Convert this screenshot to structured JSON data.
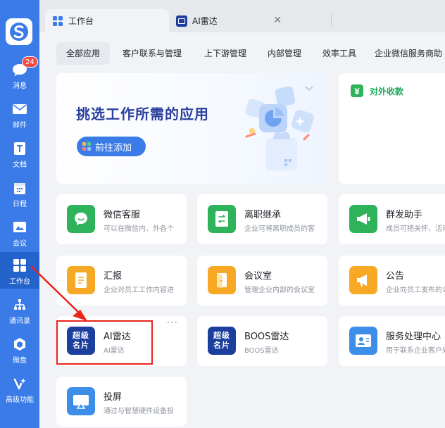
{
  "sidebar": {
    "items": [
      {
        "label": "消息",
        "icon": "chat-icon",
        "badge": "24"
      },
      {
        "label": "邮件",
        "icon": "mail-icon"
      },
      {
        "label": "文档",
        "icon": "document-icon"
      },
      {
        "label": "日程",
        "icon": "calendar-icon"
      },
      {
        "label": "会议",
        "icon": "meeting-icon"
      },
      {
        "label": "工作台",
        "icon": "workbench-icon",
        "active": true
      },
      {
        "label": "通讯录",
        "icon": "contacts-icon"
      },
      {
        "label": "微盘",
        "icon": "drive-icon"
      },
      {
        "label": "高级功能",
        "icon": "advanced-icon"
      }
    ]
  },
  "tabs": [
    {
      "title": "工作台",
      "icon": "grid-icon",
      "active": true
    },
    {
      "title": "AI雷达",
      "icon": "radar-app-icon",
      "close": "✕"
    }
  ],
  "categories": [
    "全部应用",
    "客户联系与管理",
    "上下游管理",
    "内部管理",
    "效率工具",
    "企业微信服务商助"
  ],
  "banner": {
    "title": "挑选工作所需的应用",
    "button": "前往添加"
  },
  "pay_card": {
    "title": "对外收款"
  },
  "apps": [
    {
      "name": "微信客服",
      "desc": "可以在微信内、外各个场景接入微信客服",
      "icon": "chat-bubble-icon",
      "color": "green"
    },
    {
      "name": "离职继承",
      "desc": "企业可将离职成员的客户分配给在职成员",
      "icon": "transfer-icon",
      "color": "green"
    },
    {
      "name": "群发助手",
      "desc": "成员可把关怀、活动消息群发给客户",
      "icon": "megaphone-icon",
      "color": "green"
    },
    {
      "name": "汇报",
      "desc": "企业对员工工作内容进行汇报",
      "icon": "report-icon",
      "color": "orange"
    },
    {
      "name": "会议室",
      "desc": "管理企业内部的会议室资源",
      "icon": "door-icon",
      "color": "orange"
    },
    {
      "name": "公告",
      "desc": "企业向员工发布的公告通知",
      "icon": "announcement-icon",
      "color": "orange"
    },
    {
      "name": "AI雷达",
      "desc": "AI雷达",
      "icon": "radar-badge-icon",
      "color": "navy",
      "badge_text": [
        "超级",
        "名片"
      ]
    },
    {
      "name": "BOOS雷达",
      "desc": "BOOS雷达",
      "icon": "radar-badge-icon",
      "color": "navy",
      "badge_text": [
        "超级",
        "名片"
      ]
    },
    {
      "name": "服务处理中心",
      "desc": "用于联系企业客户处理服务",
      "icon": "service-icon",
      "color": "blue"
    },
    {
      "name": "投屏",
      "desc": "通过与智慧硬件设备投屏",
      "icon": "screencast-icon",
      "color": "blue"
    }
  ],
  "more_label": "···",
  "colors": {
    "sidebar": "#3a7be8",
    "accent": "#3a7be8",
    "highlight": "#e8241d",
    "green": "#2eb35a",
    "orange": "#f7a825"
  }
}
